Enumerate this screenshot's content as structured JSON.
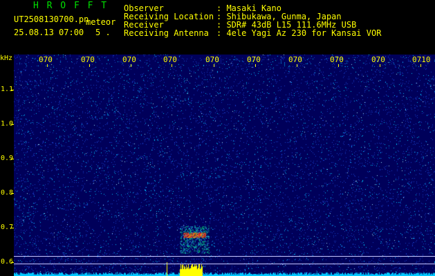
{
  "header": {
    "title": "H R O F F T",
    "file_name": "UT2508130700.pn",
    "type_label": "meteor",
    "date_time": "25.08.13 07:00",
    "count": "5 .",
    "info_labels": {
      "observer": "Observer",
      "location": "Receiving Location",
      "receiver": "Receiver",
      "antenna": "Receiving Antenna"
    },
    "info_values": {
      "observer": ": Masaki Kano",
      "location": ": Shibukawa, Gunma, Japan",
      "receiver": ": SDR# 43dB L15 111.6MHz USB",
      "antenna": ": 4ele Yagi Az 230 for Kansai VOR"
    }
  },
  "y_axis": {
    "unit": "kHz",
    "ticks": [
      "1.1",
      "1.0",
      "0.9",
      "0.8",
      "0.7",
      "0.6"
    ]
  },
  "x_axis": {
    "ticks": [
      "070",
      "070",
      "070",
      "070",
      "070",
      "070",
      "070",
      "070",
      "070",
      "0710"
    ]
  },
  "colors": {
    "background": "#00005a",
    "text": "#ffff00",
    "title": "#00e000",
    "noise": "#00c8ff",
    "echo_hot": "#ff2020",
    "echo_mid": "#00ff80",
    "baseline": "#ffff00"
  }
}
